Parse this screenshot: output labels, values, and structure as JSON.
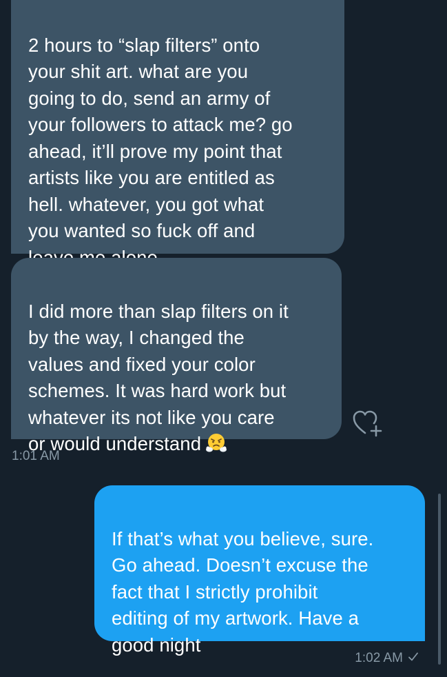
{
  "conversation": {
    "messages": [
      {
        "direction": "received",
        "text": "2 hours to “slap filters” onto\nyour shit art. what are you\ngoing to do, send an army of\nyour followers to attack me? go\nahead, it’ll prove my point that\nartists like you are entitled as\nhell. whatever, you got what\nyou wanted so fuck off and\nleave me alone."
      },
      {
        "direction": "received",
        "text": "I did more than slap filters on it\nby the way, I changed the\nvalues and fixed your color\nschemes. It was hard work but\nwhatever its not like you care\nor would understand",
        "emoji": "face-with-steam-from-nose"
      },
      {
        "direction": "sent",
        "text": "If that’s what you believe, sure.\nGo ahead. Doesn’t excuse the\nfact that I strictly prohibit\nediting of my artwork. Have a\ngood night"
      }
    ],
    "received_timestamp": "1:01 AM",
    "sent_timestamp": "1:02 AM",
    "sent_status_icon": "checkmark-icon",
    "like_icon": "heart-plus-icon"
  },
  "colors": {
    "background": "#15202b",
    "received_bubble": "#3d5466",
    "sent_bubble": "#1da1f2",
    "timestamp": "#8899a6"
  }
}
